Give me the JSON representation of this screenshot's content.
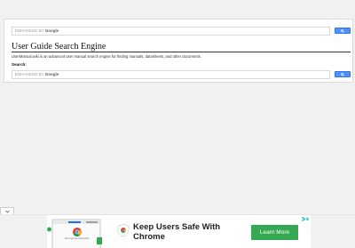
{
  "search": {
    "enhanced_label": "ENHANCED BY",
    "brand": "Google",
    "button_icon": "search-icon"
  },
  "page": {
    "title": "User Guide Search Engine",
    "description": "UserManual.wiki is an advanced user manual search engine for finding manuals, datasheets, and other documents.",
    "search_label": "Search:"
  },
  "ad": {
    "laptop_label": "chrome.com/security",
    "headline": "Keep Users Safe With Chrome",
    "cta": "Learn More",
    "cta_color": "#34a853",
    "adchoices_icon": "adchoices-icon"
  },
  "colors": {
    "search_button": "#4d90fe",
    "background": "#f1f1f1"
  }
}
